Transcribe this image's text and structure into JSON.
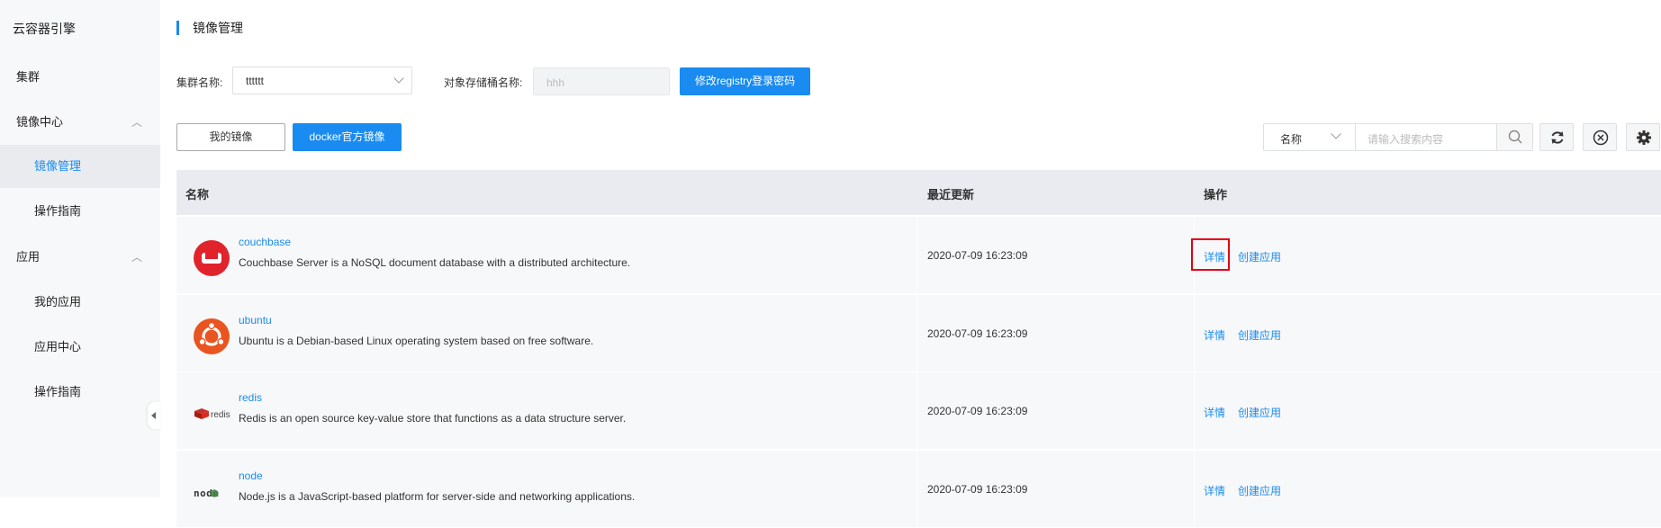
{
  "sidebar": {
    "brand": "云容器引擎",
    "items": [
      {
        "label": "集群"
      },
      {
        "label": "镜像中心",
        "expand": "︿"
      },
      {
        "label": "镜像管理"
      },
      {
        "label": "操作指南"
      },
      {
        "label": "应用",
        "expand": "︿"
      },
      {
        "label": "我的应用"
      },
      {
        "label": "应用中心"
      },
      {
        "label": "操作指南"
      }
    ]
  },
  "page": {
    "title": "镜像管理"
  },
  "filters": {
    "cluster_label": "集群名称:",
    "cluster_value": "tttttt",
    "bucket_label": "对象存储桶名称:",
    "bucket_value": "hhh",
    "registry_button": "修改registry登录密码"
  },
  "tabs": {
    "mine": "我的镜像",
    "docker": "docker官方镜像"
  },
  "search": {
    "field": "名称",
    "placeholder": "请输入搜索内容"
  },
  "table": {
    "headers": {
      "name": "名称",
      "updated": "最近更新",
      "ops": "操作"
    },
    "rows": [
      {
        "name": "couchbase",
        "desc": "Couchbase Server is a NoSQL document database with a distributed architecture.",
        "time": "2020-07-09 16:23:09",
        "detail": "详情",
        "create": "创建应用"
      },
      {
        "name": "ubuntu",
        "desc": "Ubuntu is a Debian-based Linux operating system based on free software.",
        "time": "2020-07-09 16:23:09",
        "detail": "详情",
        "create": "创建应用"
      },
      {
        "name": "redis",
        "desc": "Redis is an open source key-value store that functions as a data structure server.",
        "time": "2020-07-09 16:23:09",
        "detail": "详情",
        "create": "创建应用"
      },
      {
        "name": "node",
        "desc": "Node.js is a JavaScript-based platform for server-side and networking applications.",
        "time": "2020-07-09 16:23:09",
        "detail": "详情",
        "create": "创建应用"
      }
    ]
  },
  "logos": {
    "redis_word": "redis",
    "node_word": "node"
  },
  "colors": {
    "primary": "#1a8bf0",
    "couchbase": "#e1232b",
    "ubuntu": "#e95420",
    "highlight": "#e60012"
  },
  "icons": [
    "chevron-up-icon",
    "chevron-down-icon",
    "search-icon",
    "refresh-icon",
    "close-circle-icon",
    "gear-icon",
    "collapse-left-icon"
  ]
}
